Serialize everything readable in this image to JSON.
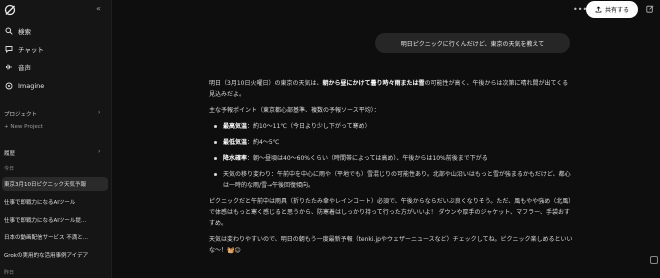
{
  "sidebar": {
    "nav": [
      {
        "label": "検索",
        "icon": "search-icon"
      },
      {
        "label": "チャット",
        "icon": "chat-icon"
      },
      {
        "label": "音声",
        "icon": "voice-icon"
      },
      {
        "label": "Imagine",
        "icon": "imagine-icon"
      }
    ],
    "projects_title": "プロジェクト",
    "new_project": "+ New Project",
    "history_title": "履歴",
    "today_label": "今日",
    "history": [
      "東京3月10日ピクニック天気予報",
      "仕事で即戦力になるAIツール",
      "仕事で即戦力になるAIツール提...",
      "日本の動画配信サービス 不満と...",
      "Grokの実用的な活用事例アイデア"
    ],
    "yesterday_label": "昨日"
  },
  "header": {
    "share_label": "共有する"
  },
  "user_message": "明日ピクニックに行くんだけど、東京の天気を教えて",
  "response": {
    "intro_1": "明日（3月10日火曜日）の東京の天気は、",
    "intro_bold": "朝から昼にかけて曇り時々雨または雪",
    "intro_2": "の可能性が高く、午後からは次第に晴れ間が出てくる見込みだよ。",
    "points_title": "主な予報ポイント（東京都心部基準、複数の予報ソース平均）：",
    "points": [
      {
        "label": "最高気温",
        "text": "：約10〜11℃（今日より少し下がって寒め）"
      },
      {
        "label": "最低気温",
        "text": "：約4〜5℃"
      },
      {
        "label": "降水確率",
        "text": "：朝〜昼頃は40〜60%くらい（時間帯によっては高め）、午後からは10%前後まで下がる"
      },
      {
        "label": "",
        "text": "天気の移り変わり：午前中を中心に雨や（平地でも）雪混じりの可能性あり。北部や山沿いはもっと雪が強まるかもだけど、都心は一時的な雨/雪→午後回復傾向。"
      }
    ],
    "advice": "ピクニックだと午前中は雨具（折りたたみ傘やレインコート）必須で、午後からならだいぶ良くなりそう。ただ、風もやや強め（北風）で体感はもっと寒く感じると思うから、防寒着はしっかり持って行った方がいいよ！ ダウンや厚手のジャケット、マフラー、手袋おすすめ。",
    "closing": "天気は変わりやすいので、明日の朝もう一度最新予報（tenki.jpやウェザーニュースなど）チェックしてね。ピクニック楽しめるといいな～！🧺😊"
  }
}
